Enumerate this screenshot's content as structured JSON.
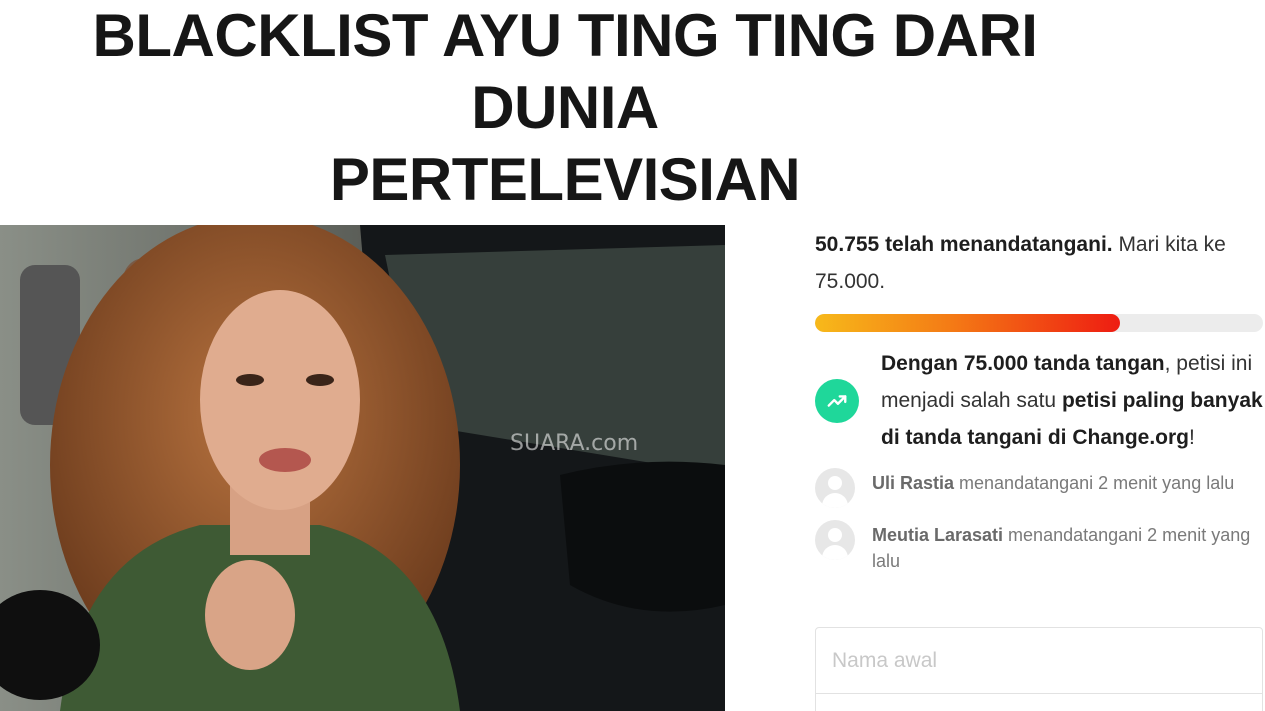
{
  "petition": {
    "title_line1": "BLACKLIST AYU TING TING DARI DUNIA",
    "title_line2": "PERTELEVISIAN"
  },
  "hero_image": {
    "watermark": "SUARA.com"
  },
  "progress": {
    "signed_bold": "50.755 telah menandatangani.",
    "goal_text": " Mari kita ke 75.000.",
    "fraction": 0.68,
    "colors": {
      "start": "#f7b91a",
      "mid": "#f47a15",
      "end": "#ee1c12",
      "track": "#ececec"
    }
  },
  "milestone": {
    "icon": "trending-up-icon",
    "icon_color": "#1fd79a",
    "part1_bold": "Dengan 75.000 tanda tangan",
    "part2": ", petisi ini menjadi salah satu ",
    "part3_bold": "petisi paling banyak di tanda tangani di Change.org",
    "part4": "!"
  },
  "recent_signers": [
    {
      "name": "Uli Rastia",
      "action": " menandatangani 2 menit yang lalu"
    },
    {
      "name": "Meutia Larasati",
      "action": " menandatangani 2 menit yang lalu"
    }
  ],
  "form": {
    "first_name_placeholder": "Nama awal"
  }
}
